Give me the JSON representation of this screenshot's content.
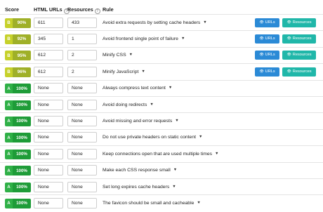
{
  "columns": {
    "score": "Score",
    "html": "HTML URLs",
    "resources": "Resources",
    "rule": "Rule"
  },
  "buttons": {
    "urls": "URLs",
    "resources": "Resources"
  },
  "rows": [
    {
      "grade": "B",
      "pct": "90%",
      "html": "611",
      "res": "433",
      "rule": "Avoid extra requests by setting cache headers",
      "buttons": true
    },
    {
      "grade": "B",
      "pct": "92%",
      "html": "345",
      "res": "1",
      "rule": "Avoid frontend single point of failure",
      "buttons": true
    },
    {
      "grade": "B",
      "pct": "95%",
      "html": "612",
      "res": "2",
      "rule": "Minify CSS",
      "buttons": true
    },
    {
      "grade": "B",
      "pct": "96%",
      "html": "612",
      "res": "2",
      "rule": "Minify JavaScript",
      "buttons": true
    },
    {
      "grade": "A",
      "pct": "100%",
      "html": "None",
      "res": "None",
      "rule": "Always compress text content",
      "buttons": false
    },
    {
      "grade": "A",
      "pct": "100%",
      "html": "None",
      "res": "None",
      "rule": "Avoid doing redirects",
      "buttons": false
    },
    {
      "grade": "A",
      "pct": "100%",
      "html": "None",
      "res": "None",
      "rule": "Avoid missing and error requests",
      "buttons": false
    },
    {
      "grade": "A",
      "pct": "100%",
      "html": "None",
      "res": "None",
      "rule": "Do not use private headers on static content",
      "buttons": false
    },
    {
      "grade": "A",
      "pct": "100%",
      "html": "None",
      "res": "None",
      "rule": "Keep connections open that are used multiple times",
      "buttons": false
    },
    {
      "grade": "A",
      "pct": "100%",
      "html": "None",
      "res": "None",
      "rule": "Make each CSS response small",
      "buttons": false
    },
    {
      "grade": "A",
      "pct": "100%",
      "html": "None",
      "res": "None",
      "rule": "Set long expires cache headers",
      "buttons": false
    },
    {
      "grade": "A",
      "pct": "100%",
      "html": "None",
      "res": "None",
      "rule": "The favicon should be small and cacheable",
      "buttons": false
    }
  ],
  "icons": {
    "help": "question-circle-icon",
    "caret": "caret-down-icon",
    "eye": "eye-icon"
  },
  "colors": {
    "grade_b": "#9fb028",
    "grade_a": "#1e9c38",
    "urls_button": "#2b8ad6",
    "resources_button": "#20b7a9"
  }
}
